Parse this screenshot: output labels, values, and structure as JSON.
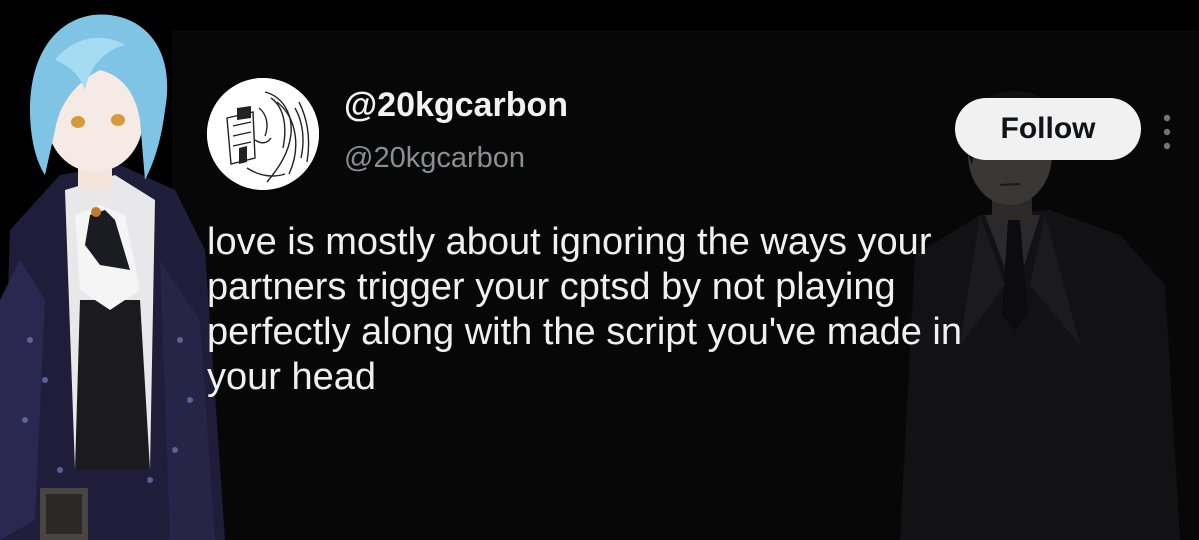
{
  "tweet": {
    "display_name": "@20kgcarbon",
    "handle": "@20kgcarbon",
    "follow_label": "Follow",
    "text": "love is mostly about ignoring the ways your\npartners trigger your cptsd by not playing\nperfectly along with the script you've made in\nyour head"
  },
  "icons": {
    "more": "more-vertical-icon",
    "avatar": "avatar-sketch"
  },
  "colors": {
    "background": "#000000",
    "card": "#070708",
    "text_primary": "#f0f0f0",
    "text_secondary": "#8a8f95",
    "follow_bg": "#f1f1f1",
    "follow_text": "#0f1419"
  }
}
